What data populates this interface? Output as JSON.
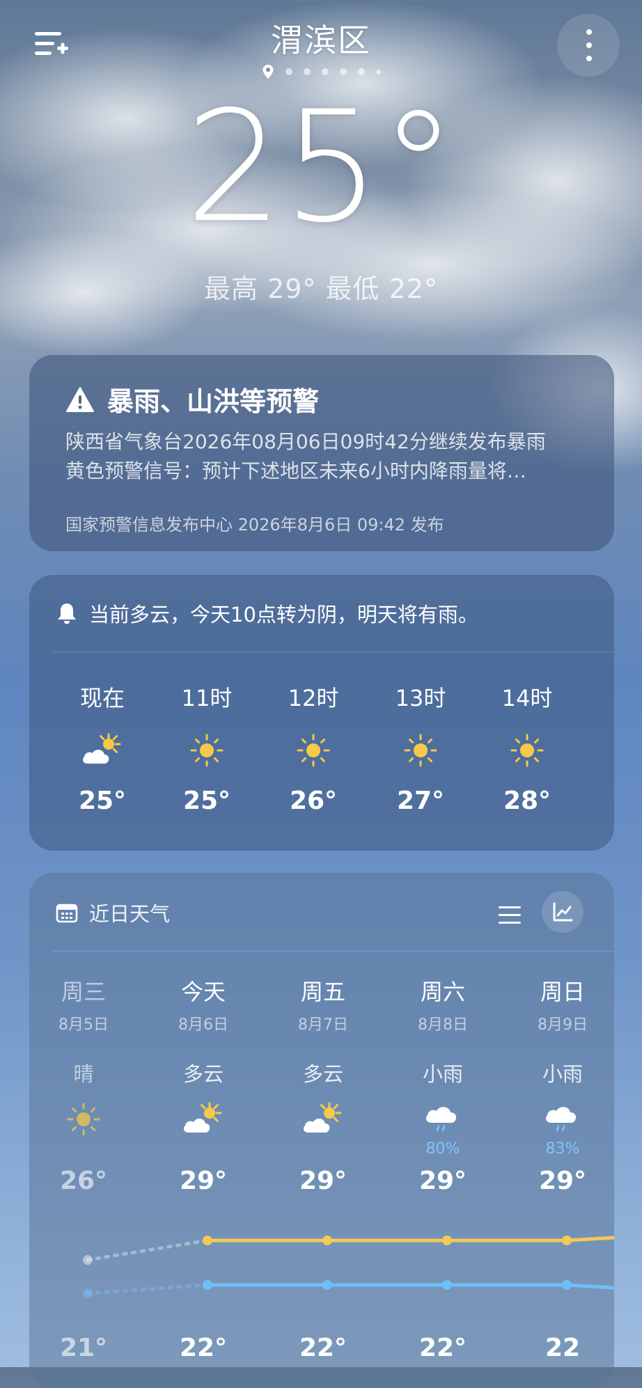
{
  "location": {
    "city": "渭滨区"
  },
  "current": {
    "temp": "25°",
    "high_low": "最高 29° 最低 22°"
  },
  "alert": {
    "title": "暴雨、山洪等预警",
    "body_line1": "陕西省气象台2026年08月06日09时42分继续发布暴雨",
    "body_line2": "黄色预警信号：预计下述地区未来6小时内降雨量将…",
    "source": "国家预警信息发布中心 2026年8月6日 09:42 发布"
  },
  "hourly": {
    "notice": "当前多云，今天10点转为阴，明天将有雨。",
    "hours": [
      {
        "label": "现在",
        "icon": "partly-cloudy-icon",
        "temp": "25°"
      },
      {
        "label": "11时",
        "icon": "sun-icon",
        "temp": "25°"
      },
      {
        "label": "12时",
        "icon": "sun-icon",
        "temp": "26°"
      },
      {
        "label": "13时",
        "icon": "sun-icon",
        "temp": "27°"
      },
      {
        "label": "14时",
        "icon": "sun-icon",
        "temp": "28°"
      }
    ]
  },
  "daily": {
    "title": "近日天气",
    "days": [
      {
        "name": "周三",
        "date": "8月5日",
        "cond": "晴",
        "icon": "sun-icon",
        "precip": "",
        "high": "26°",
        "low": "21°"
      },
      {
        "name": "今天",
        "date": "8月6日",
        "cond": "多云",
        "icon": "partly-cloudy-icon",
        "precip": "",
        "high": "29°",
        "low": "22°"
      },
      {
        "name": "周五",
        "date": "8月7日",
        "cond": "多云",
        "icon": "partly-cloudy-icon",
        "precip": "",
        "high": "29°",
        "low": "22°"
      },
      {
        "name": "周六",
        "date": "8月8日",
        "cond": "小雨",
        "icon": "rain-cloud-icon",
        "precip": "80%",
        "high": "29°",
        "low": "22°"
      },
      {
        "name": "周日",
        "date": "8月9日",
        "cond": "小雨",
        "icon": "rain-cloud-icon",
        "precip": "83%",
        "high": "29°",
        "low": "22"
      }
    ]
  },
  "colors": {
    "high_line": "#f5c85a",
    "low_line": "#6cc0f5",
    "sun": "#f7c948",
    "precip": "#7fc4ff"
  }
}
